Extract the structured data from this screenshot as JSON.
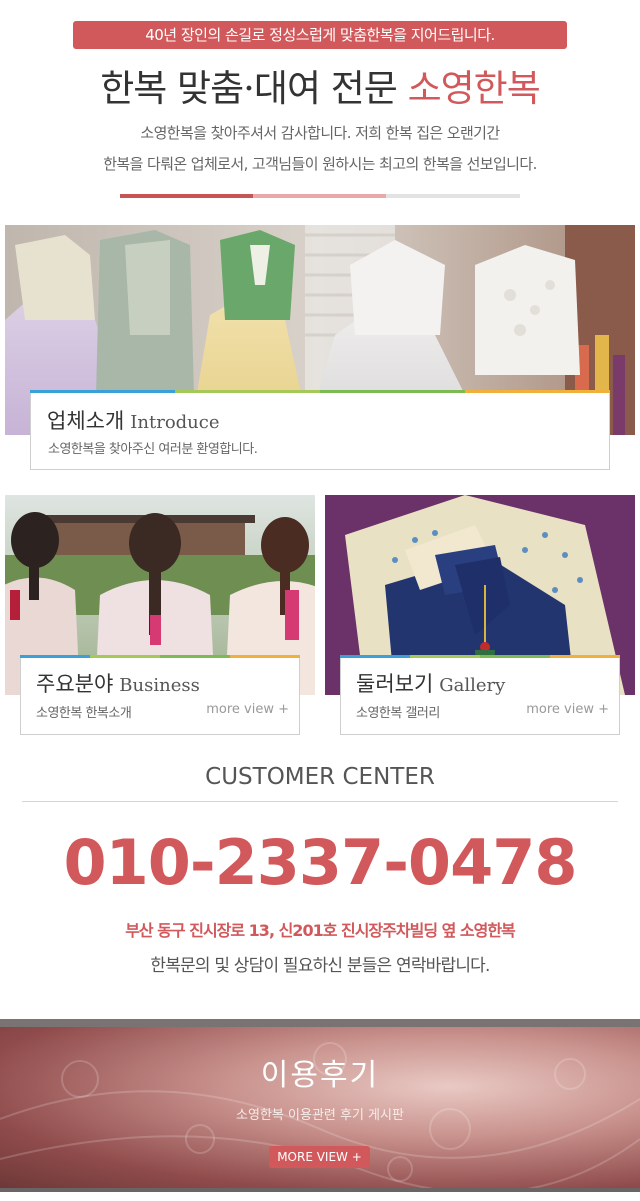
{
  "header": {
    "tagline": "40년 장인의 손길로 정성스럽게 맞춤한복을 지어드립니다.",
    "title_main": "한복 맞춤·대여 전문",
    "title_accent": "소영한복",
    "intro_line1": "소영한복을 찾아주셔서 감사합니다. 저희 한복 집은 오랜기간",
    "intro_line2": "한복을 다뤄온 업체로서, 고객님들이 원하시는 최고의 한복을 선보입니다."
  },
  "introduce": {
    "title": "업체소개",
    "title_en": "Introduce",
    "subtitle": "소영한복을 찾아주신 여러분 환영합니다."
  },
  "business": {
    "title": "주요분야",
    "title_en": "Business",
    "subtitle": "소영한복 한복소개",
    "more": "more view +"
  },
  "gallery": {
    "title": "둘러보기",
    "title_en": "Gallery",
    "subtitle": "소영한복 갤러리",
    "more": "more view +"
  },
  "customer_center": {
    "title": "CUSTOMER CENTER",
    "phone": "010-2337-0478",
    "address": "부산 동구 진시장로 13, 신201호 진시장주차빌딩 옆 소영한복",
    "note": "한복문의 및 상담이 필요하신 분들은 연락바랍니다."
  },
  "review": {
    "title": "이용후기",
    "subtitle": "소영한복 이용관련 후기 게시판",
    "button": "MORE VIEW +"
  },
  "colors": {
    "accent": "#d2595b",
    "caption_stripe": [
      "#3aa0d8",
      "#a5c957",
      "#7dbb52",
      "#f0b03a"
    ]
  }
}
